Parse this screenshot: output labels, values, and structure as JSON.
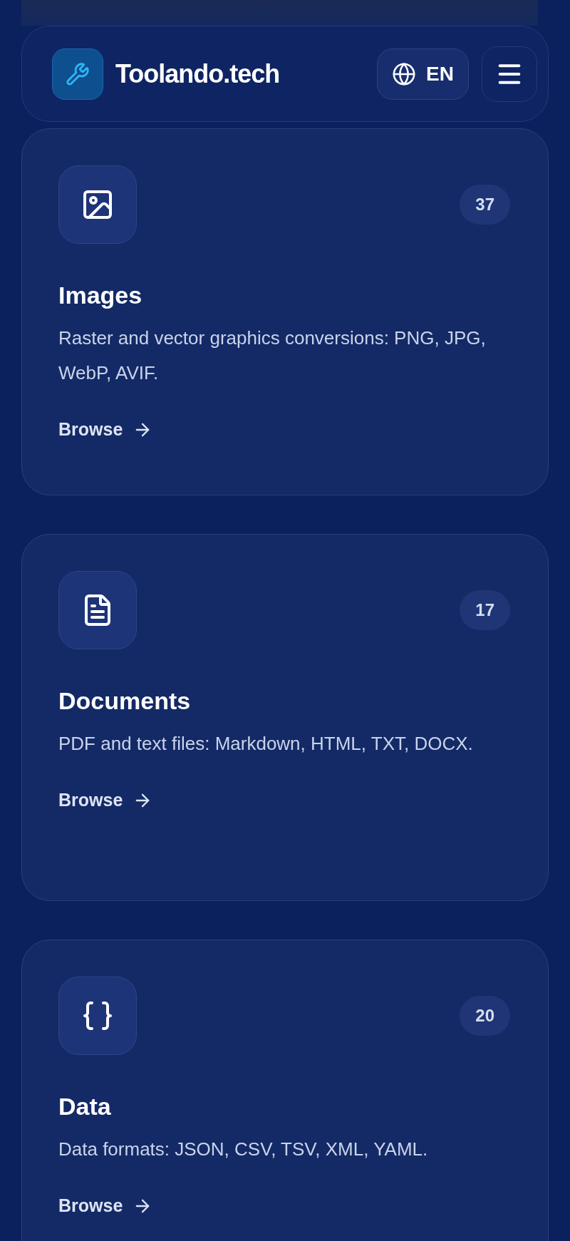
{
  "header": {
    "brand": "Toolando.tech",
    "language": "EN"
  },
  "categories": [
    {
      "kind": "image",
      "count": "37",
      "title": "Images",
      "description": "Raster and vector graphics conversions: PNG, JPG, WebP, AVIF.",
      "link": "Browse"
    },
    {
      "kind": "document",
      "count": "17",
      "title": "Documents",
      "description": "PDF and text files: Markdown, HTML, TXT, DOCX.",
      "link": "Browse"
    },
    {
      "kind": "data",
      "count": "20",
      "title": "Data",
      "description": "Data formats: JSON, CSV, TSV, XML, YAML.",
      "link": "Browse"
    }
  ]
}
